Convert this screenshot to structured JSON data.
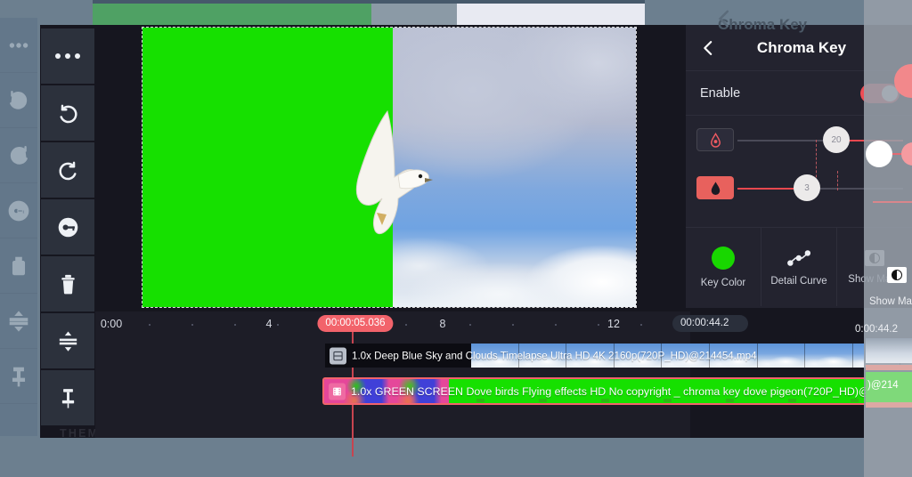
{
  "app": {
    "watermark": "THEMODSWORLD.COM"
  },
  "toolbar": {
    "items": [
      {
        "name": "more-options",
        "icon": "ellipsis-icon"
      },
      {
        "name": "undo",
        "icon": "undo-icon"
      },
      {
        "name": "redo",
        "icon": "redo-icon"
      },
      {
        "name": "key-frame",
        "icon": "key-icon"
      },
      {
        "name": "delete",
        "icon": "trash-icon"
      },
      {
        "name": "fit-to-screen",
        "icon": "expand-vertical-icon"
      },
      {
        "name": "pin",
        "icon": "pin-icon"
      }
    ]
  },
  "panel": {
    "title": "Chroma Key",
    "back_icon": "chevron-left-icon",
    "enable_label": "Enable",
    "enable_on": true,
    "accent": "#ef4d55",
    "sliders": [
      {
        "name": "key-strength",
        "icon": "chroma-outline-icon",
        "value": "20",
        "percent": 57
      },
      {
        "name": "cut-off",
        "icon": "chroma-filled-icon",
        "value": "3",
        "percent": 41
      }
    ],
    "tabs": [
      {
        "label": "Key Color",
        "icon": "green-swatch-icon",
        "color": "#18d700"
      },
      {
        "label": "Detail Curve",
        "icon": "curve-icon"
      },
      {
        "label": "Show Mask",
        "icon": "contrast-icon"
      }
    ]
  },
  "ghost_panel": {
    "tab_label": "Show Mask",
    "title": "Chroma Key"
  },
  "timeline": {
    "ruler_labels": [
      "0:00",
      "4",
      "8",
      "12"
    ],
    "playhead_time": "00:00:05.036",
    "total_time": "00:00:44.2",
    "ghost_total_time": "0:00:44.2",
    "clips": [
      {
        "name": "clip-background",
        "speed": "1.0x",
        "title": "1.0x Deep Blue Sky and Clouds Timelapse Ultra HD 4K 2160p(720P_HD)@214454.mp4",
        "icon": "video-layer-icon",
        "selected": false
      },
      {
        "name": "clip-greenscreen",
        "speed": "1.0x",
        "title": "1.0x GREEN SCREEN Dove birds Flying effects HD No copyright _ chroma key dove pigeon(720P_HD)@214",
        "icon": "film-icon",
        "selected": true
      }
    ],
    "ghost_clip_label": ")@214"
  },
  "preview": {
    "name": "video-preview",
    "green_color": "#16e000",
    "description": "dove flying, left half green screen, right half sky"
  }
}
